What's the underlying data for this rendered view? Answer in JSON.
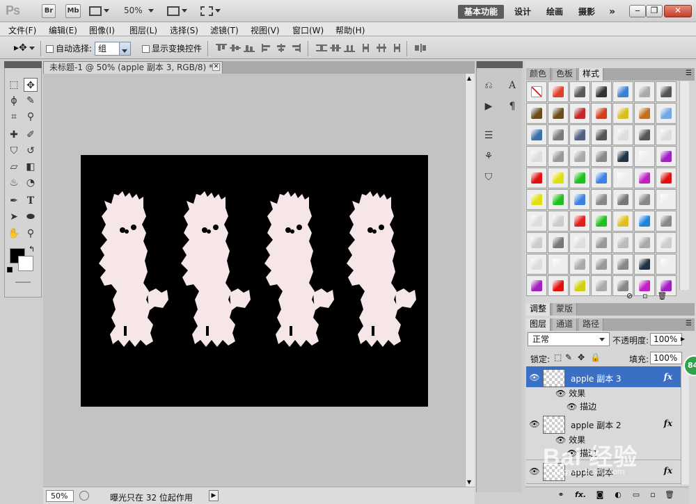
{
  "appbar": {
    "logo": "Ps",
    "bridge": "Br",
    "minibridge": "Mb",
    "zoom": "50%",
    "workspaces": [
      "基本功能",
      "设计",
      "绘画",
      "摄影"
    ],
    "more": "»"
  },
  "menubar": [
    "文件(F)",
    "编辑(E)",
    "图像(I)",
    "图层(L)",
    "选择(S)",
    "滤镜(T)",
    "视图(V)",
    "窗口(W)",
    "帮助(H)"
  ],
  "options": {
    "auto_select": "自动选择:",
    "group": "组",
    "show_transform": "显示变换控件"
  },
  "document": {
    "tab_title": "未标题-1 @ 50% (apple 副本 3, RGB/8) *",
    "zoom": "50%",
    "status": "曝光只在 32 位起作用"
  },
  "panels": {
    "top_tabs": [
      "颜色",
      "色板",
      "样式"
    ],
    "adj_tabs": [
      "调整",
      "蒙版"
    ],
    "layer_tabs": [
      "图层",
      "通道",
      "路径"
    ],
    "blend_mode": "正常",
    "opacity_label": "不透明度:",
    "opacity": "100%",
    "lock_label": "锁定:",
    "fill_label": "填充:",
    "fill": "100%"
  },
  "layers": [
    {
      "name": "apple 副本 3",
      "effects": "效果",
      "stroke": "描边"
    },
    {
      "name": "apple 副本 2",
      "effects": "效果",
      "stroke": "描边"
    },
    {
      "name": "apple 副本"
    }
  ],
  "badge": "84",
  "watermark": {
    "text": "Bai 经验",
    "url": "jingyan.baidu.com"
  },
  "colors": {
    "accent": "#3a6fc4",
    "canvas": "#000000",
    "shape": "#f7e6e8"
  }
}
